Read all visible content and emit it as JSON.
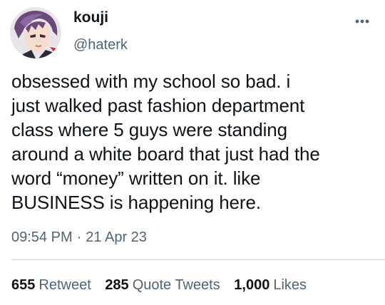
{
  "author": {
    "display_name": "kouji",
    "handle": "@haterk",
    "avatar_icon": "anime-character-avatar"
  },
  "more_icon": "more-horizontal-icon",
  "tweet": {
    "text": "obsessed with my school so bad. i\njust walked past fashion department\nclass where 5 guys were standing\naround a white board that just had the\nword “money” written on it. like\nBUSINESS is happening here."
  },
  "meta": {
    "time": "09:54 PM",
    "separator": "·",
    "date": "21 Apr 23"
  },
  "stats": {
    "retweets": {
      "count": "655",
      "label": "Retweet"
    },
    "quotes": {
      "count": "285",
      "label": "Quote Tweets"
    },
    "likes": {
      "count": "1,000",
      "label": "Likes"
    }
  },
  "colors": {
    "text_primary": "#0f1419",
    "text_secondary": "#536471",
    "divider": "#d9dde1",
    "background": "#ffffff"
  }
}
